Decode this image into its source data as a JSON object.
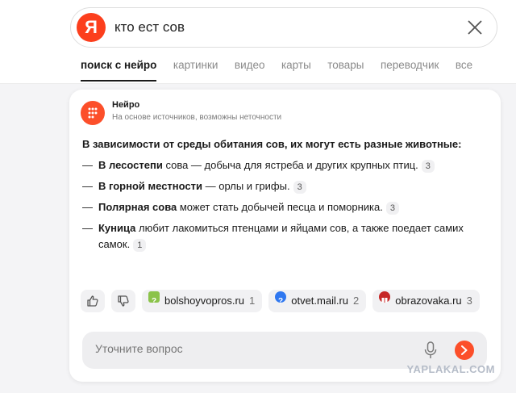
{
  "search": {
    "logo": "Я",
    "query": "кто ест сов"
  },
  "tabs": [
    {
      "label": "поиск с нейро",
      "active": true
    },
    {
      "label": "картинки"
    },
    {
      "label": "видео"
    },
    {
      "label": "карты"
    },
    {
      "label": "товары"
    },
    {
      "label": "переводчик"
    },
    {
      "label": "все"
    }
  ],
  "neuro": {
    "title": "Нейро",
    "subtitle": "На основе источников, возможны неточности",
    "intro": "В зависимости от среды обитания сов, их могут есть разные животные:",
    "items": [
      {
        "bold": "В лесостепи",
        "text": " сова — добыча для ястреба и других крупных птиц.",
        "ref": "3"
      },
      {
        "bold": "В горной местности",
        "text": " — орлы и грифы.",
        "ref": "3"
      },
      {
        "bold": "Полярная сова",
        "text": " может стать добычей песца и поморника.",
        "ref": "3"
      },
      {
        "bold": "Куница",
        "text": " любит лакомиться птенцами и яйцами сов, а также поедает самих самок.",
        "ref": "1"
      }
    ],
    "sources": [
      {
        "name": "bolshoyvopros.ru",
        "num": "1",
        "color": "#8bc34a"
      },
      {
        "name": "otvet.mail.ru",
        "num": "2",
        "color": "#2f78f0"
      },
      {
        "name": "obrazovaka.ru",
        "num": "3",
        "color": "#c62828"
      }
    ],
    "ask_placeholder": "Уточните вопрос"
  },
  "watermark": "YAPLAKAL.COM"
}
